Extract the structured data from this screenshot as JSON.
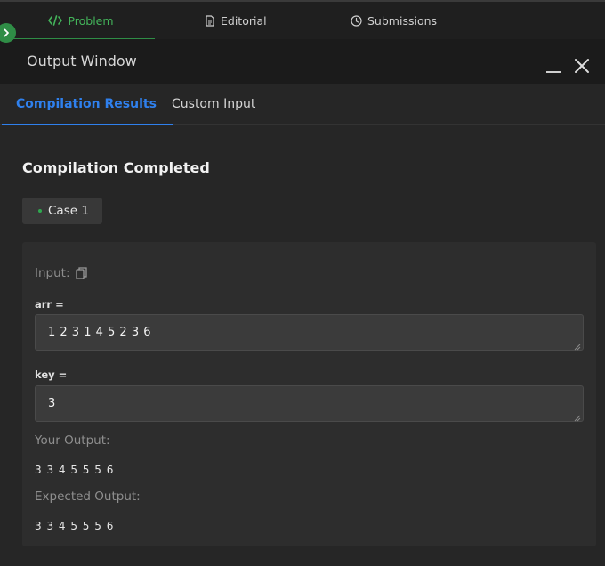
{
  "top_tabs": {
    "problem": "Problem",
    "editorial": "Editorial",
    "submissions": "Submissions"
  },
  "icons": {
    "problem": "code-icon",
    "editorial": "document-icon",
    "submissions": "clock-icon",
    "side_toggle": "chevron-right-icon",
    "copy": "copy-icon",
    "close": "close-icon",
    "minimize": "minimize-icon"
  },
  "colors": {
    "accent_green": "#2f8d46",
    "accent_blue": "#2f80ed"
  },
  "output_window": {
    "title": "Output Window",
    "tabs": {
      "compilation_results": "Compilation Results",
      "custom_input": "Custom Input"
    },
    "status": "Compilation Completed",
    "case_label": "Case 1",
    "input_label": "Input:",
    "inputs": {
      "arr_label": "arr =",
      "arr_value": "1 2 3 1 4 5 2 3 6",
      "key_label": "key =",
      "key_value": "3"
    },
    "your_output_label": "Your Output:",
    "your_output": "3 3 4 5 5 5 6",
    "expected_output_label": "Expected Output:",
    "expected_output": "3 3 4 5 5 5 6"
  }
}
